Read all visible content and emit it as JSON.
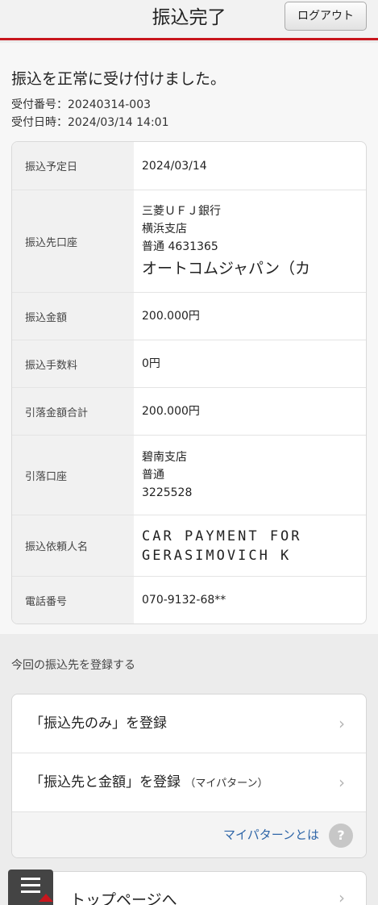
{
  "header": {
    "title": "振込完了",
    "logout_label": "ログアウト"
  },
  "result": {
    "message": "振込を正常に受け付けました。",
    "receipt_no": "受付番号：20240314-003",
    "receipt_time": "受付日時：2024/03/14 14:01"
  },
  "details": {
    "date_label": "振込予定日",
    "date_value": "2024/03/14",
    "dest_label": "振込先口座",
    "dest_bank": "三菱ＵＦＪ銀行",
    "dest_branch": "横浜支店",
    "dest_account": "普通 4631365",
    "dest_name": "オートコムジャパン（カ",
    "amount_label": "振込金額",
    "amount_value": "200.000円",
    "fee_label": "振込手数料",
    "fee_value": "0円",
    "total_label": "引落金額合計",
    "total_value": "200.000円",
    "debit_label": "引落口座",
    "debit_branch": "碧南支店",
    "debit_type": "普通",
    "debit_no": "3225528",
    "requester_label": "振込依頼人名",
    "requester_line1": "CAR PAYMENT FOR",
    "requester_line2": "GERASIMOVICH K",
    "phone_label": "電話番号",
    "phone_value": "070-9132-68**"
  },
  "register": {
    "heading": "今回の振込先を登録する",
    "item1": "「振込先のみ」を登録",
    "item2": "「振込先と金額」を登録",
    "item2_note": "（マイパターン）",
    "mypattern_link": "マイパターンとは",
    "help_icon_text": "?",
    "chevron": "›"
  },
  "top_page": {
    "label": "トップページへ"
  },
  "icons": {
    "menu": "hamburger-menu-icon",
    "help": "question-icon",
    "chevron": "chevron-right-icon"
  },
  "colors": {
    "accent": "#c8161d",
    "link": "#2f66a8"
  }
}
